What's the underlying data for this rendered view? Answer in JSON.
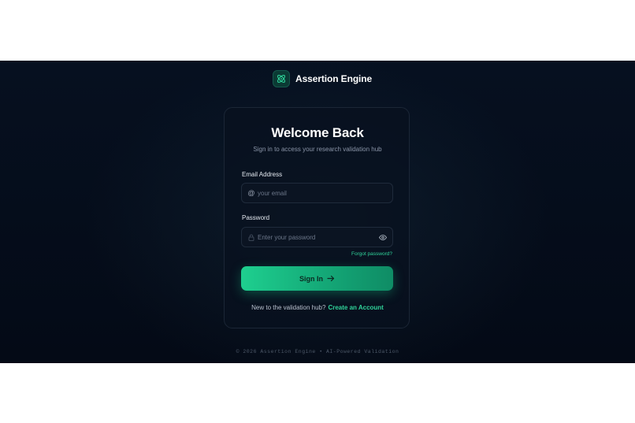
{
  "brand": {
    "name": "Assertion Engine",
    "logo_icon": "atom-icon",
    "accent_color": "#2fd39a"
  },
  "card": {
    "title": "Welcome Back",
    "subtitle": "Sign in to access your research validation hub"
  },
  "form": {
    "email": {
      "label": "Email Address",
      "placeholder": "your email",
      "value": "",
      "icon": "at-sign-icon",
      "icon_glyph": "@"
    },
    "password": {
      "label": "Password",
      "placeholder": "Enter your password",
      "value": "",
      "icon": "lock-icon",
      "toggle_icon": "eye-icon"
    },
    "forgot_label": "Forgot password?",
    "submit_label": "Sign In",
    "submit_icon": "arrow-right-icon"
  },
  "signup": {
    "prompt": "New to the validation hub?",
    "link_label": "Create an Account"
  },
  "footer": {
    "text": "© 2026 Assertion Engine • AI-Powered Validation"
  }
}
